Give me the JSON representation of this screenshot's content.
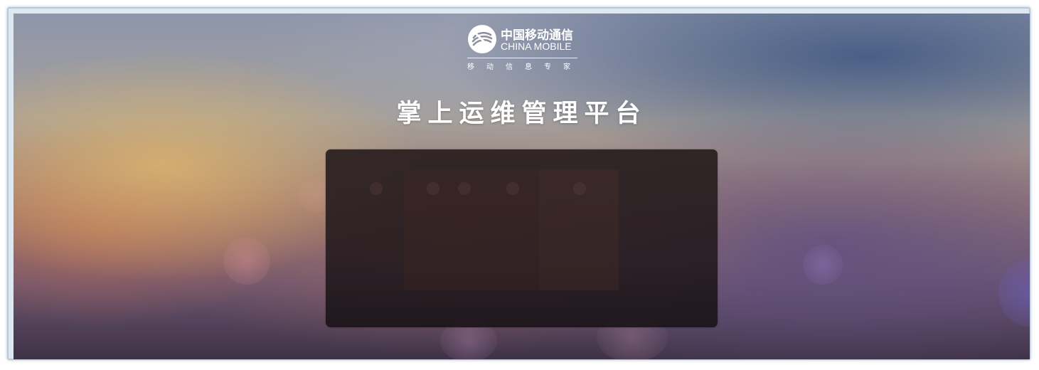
{
  "branding": {
    "logo_cn": "中国移动通信",
    "logo_en": "CHINA MOBILE",
    "slogan": "移动信息专家"
  },
  "page": {
    "title": "掌上运维管理平台"
  },
  "icons": {
    "logo": "china-mobile-logo-icon"
  },
  "colors": {
    "frame_border": "#b9c8da",
    "title_text": "#ffffff",
    "panel_bg": "#2a1f22"
  }
}
